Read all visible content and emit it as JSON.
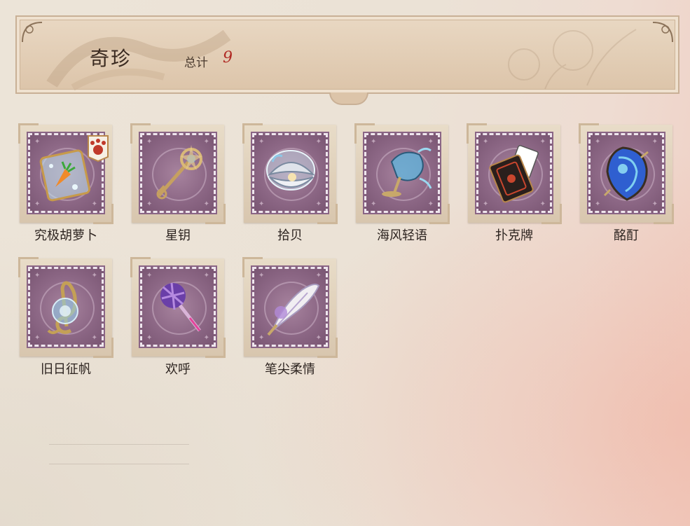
{
  "header": {
    "title": "奇珍",
    "total_label": "总计",
    "total_value": "9"
  },
  "items": [
    {
      "name": "究极胡萝卜",
      "icon": "carrot-jar-icon",
      "badge": "paw-badge-icon"
    },
    {
      "name": "星钥",
      "icon": "star-key-icon"
    },
    {
      "name": "拾贝",
      "icon": "pearl-shell-icon"
    },
    {
      "name": "海风轻语",
      "icon": "sea-breeze-goblet-icon"
    },
    {
      "name": "扑克牌",
      "icon": "playing-cards-icon"
    },
    {
      "name": "酩酊",
      "icon": "blue-gem-icon"
    },
    {
      "name": "旧日征帆",
      "icon": "treble-clef-icon"
    },
    {
      "name": "欢呼",
      "icon": "cheer-wand-icon"
    },
    {
      "name": "笔尖柔情",
      "icon": "quill-feather-icon"
    }
  ],
  "colors": {
    "stamp": "#8d6886",
    "total": "#b02a24",
    "text": "#2d2420"
  }
}
